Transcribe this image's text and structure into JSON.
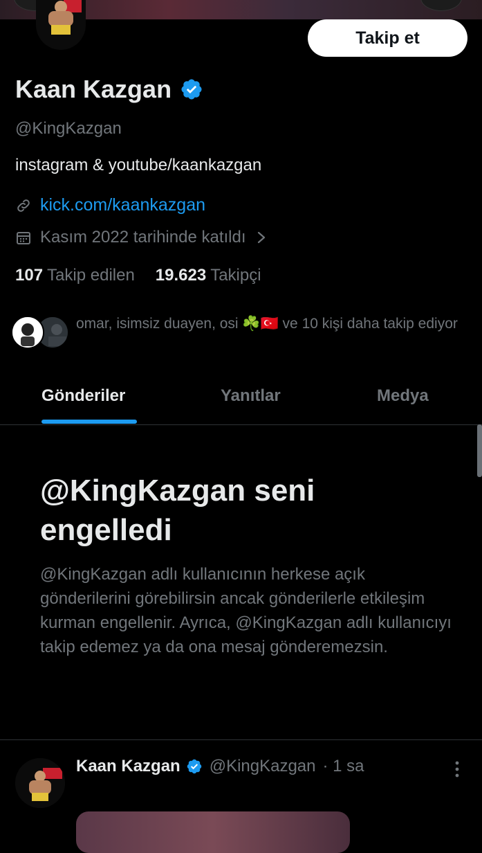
{
  "profile": {
    "display_name": "Kaan Kazgan",
    "handle": "@KingKazgan",
    "bio": "instagram & youtube/kaankazgan",
    "link": "kick.com/kaankazgan",
    "joined": "Kasım 2022 tarihinde katıldı",
    "following_count": "107",
    "following_label": "Takip edilen",
    "followers_count": "19.623",
    "followers_label": "Takipçi",
    "follow_button_label": "Takip et",
    "known_followers_text": "omar, isimsiz duayen, osi ☘️🇹🇷 ve 10 kişi daha takip ediyor"
  },
  "tabs": [
    {
      "label": "Gönderiler",
      "active": true
    },
    {
      "label": "Yanıtlar",
      "active": false
    },
    {
      "label": "Medya",
      "active": false
    }
  ],
  "blocked_notice": {
    "title": "@KingKazgan seni engelledi",
    "description": "@KingKazgan adlı kullanıcının herkese açık gönderilerini görebilirsin ancak gönderilerle etkileşim kurman engellenir. Ayrıca, @KingKazgan adlı kullanıcıyı takip edemez ya da ona mesaj gönderemezsin."
  },
  "post": {
    "author_name": "Kaan Kazgan",
    "author_handle": "@KingKazgan",
    "time": "· 1 sa"
  },
  "colors": {
    "accent": "#1d9bf0",
    "background": "#000000",
    "text_primary": "#e7e9ea",
    "text_secondary": "#71767b"
  },
  "icons": [
    "verified-badge-icon",
    "link-icon",
    "calendar-icon",
    "chevron-right-icon",
    "more-vertical-icon"
  ]
}
